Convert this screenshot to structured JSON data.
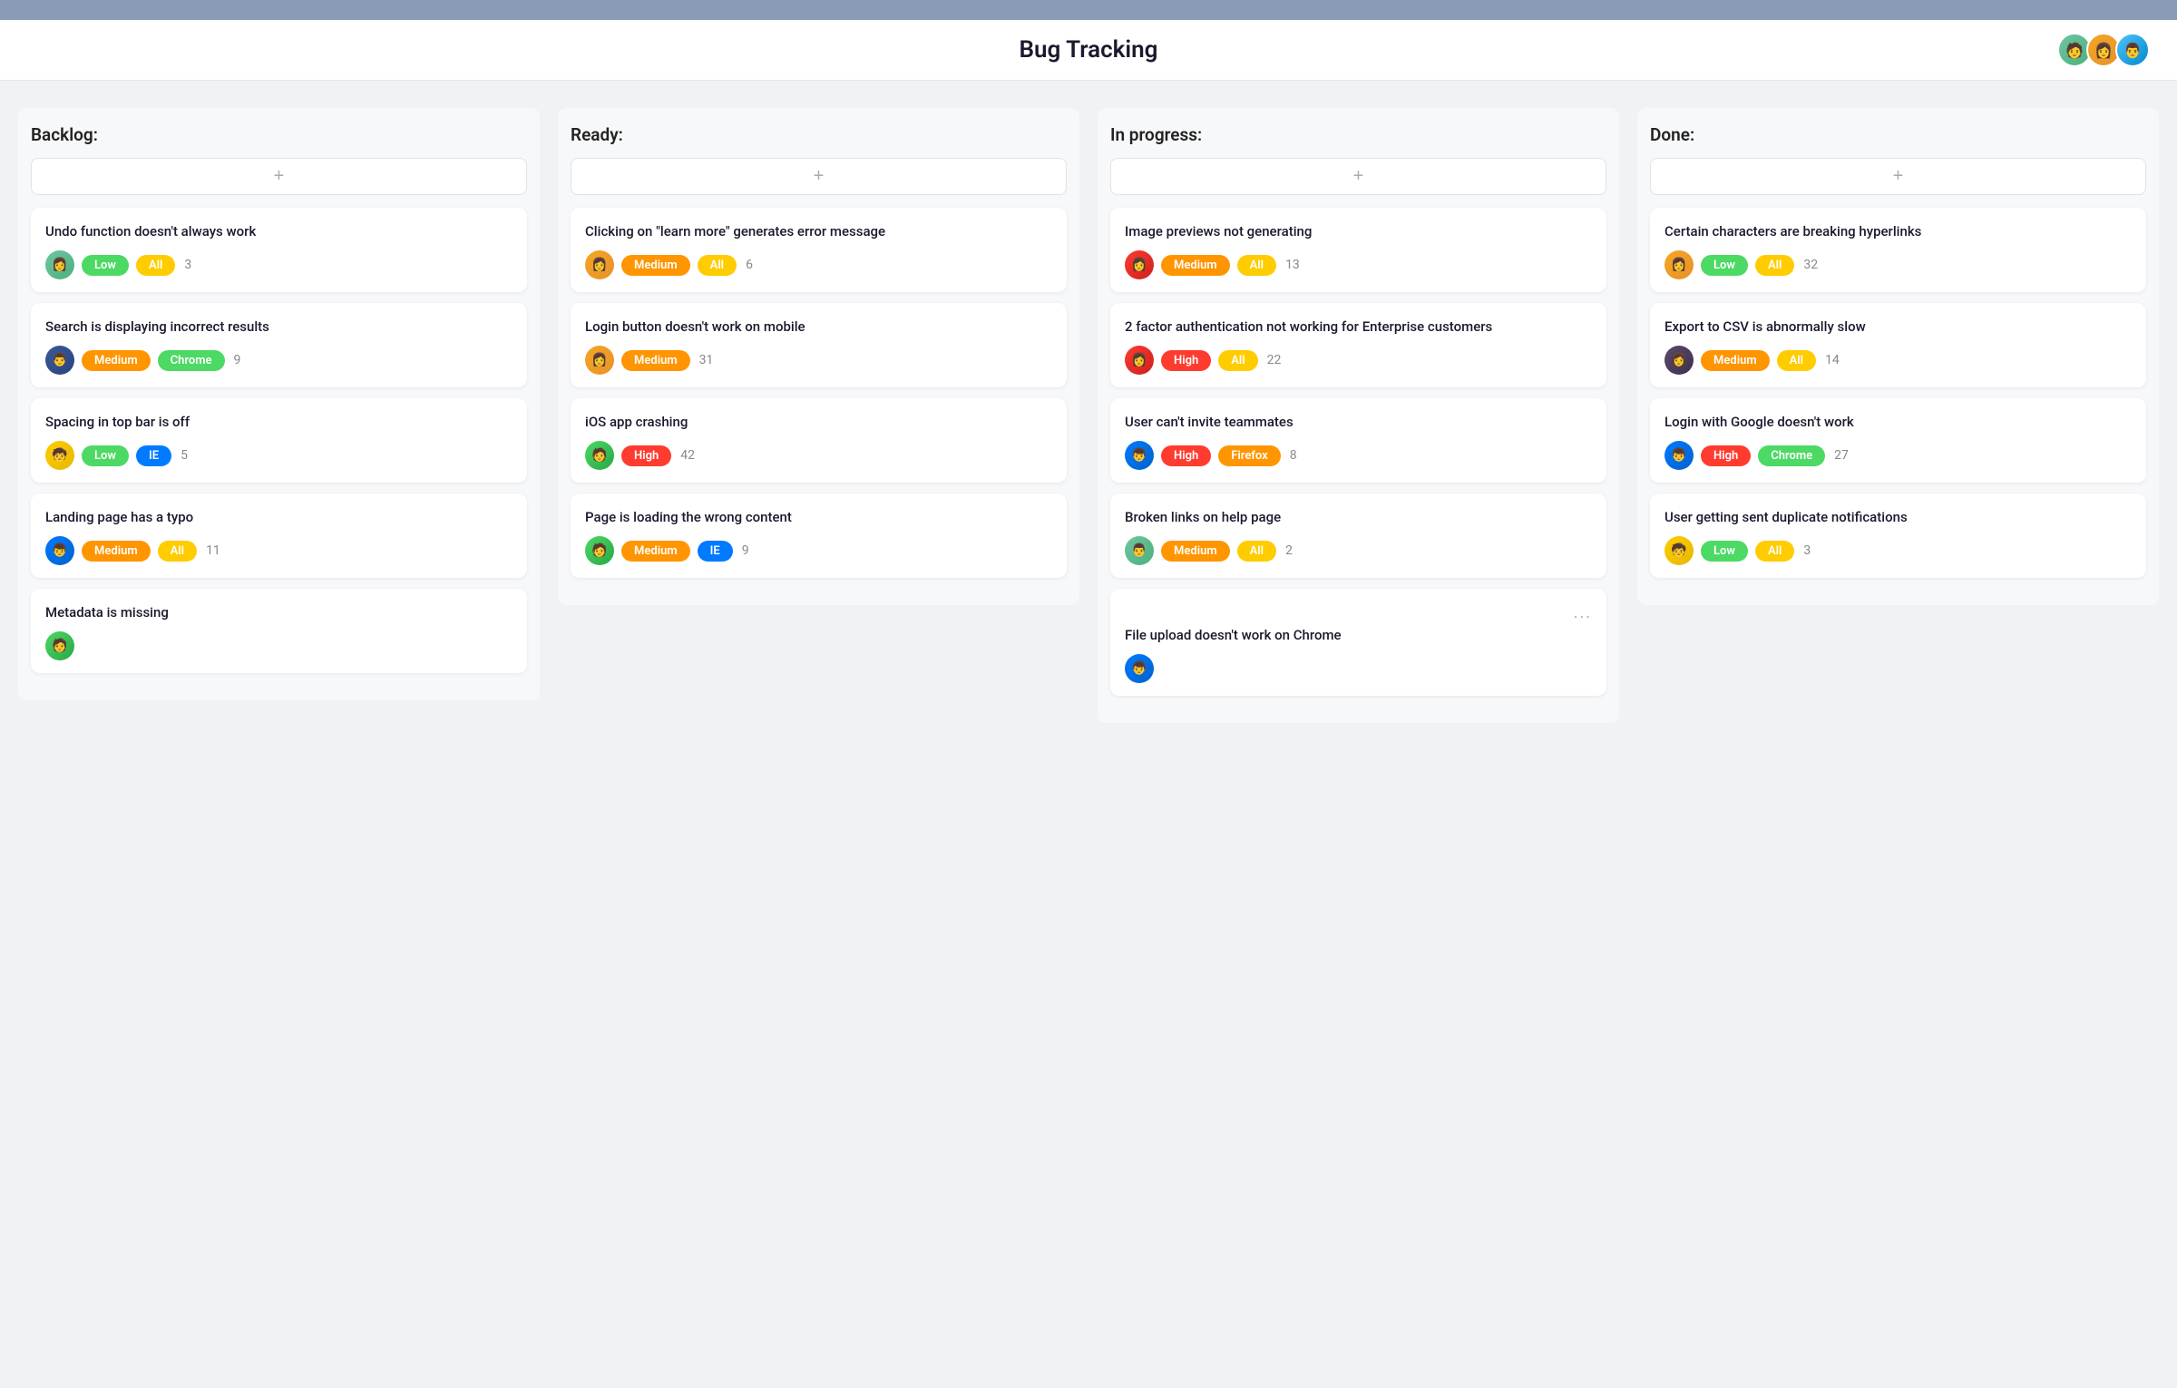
{
  "topBar": {},
  "header": {
    "title": "Bug Tracking",
    "avatars": [
      {
        "id": "av1",
        "label": "User 1",
        "color1": "#6ec6a0",
        "color2": "#4caf7d",
        "emoji": "🧑"
      },
      {
        "id": "av2",
        "label": "User 2",
        "color1": "#f5a623",
        "color2": "#e8922b",
        "emoji": "👩"
      },
      {
        "id": "av3",
        "label": "User 3",
        "color1": "#4fc3f7",
        "color2": "#0288d1",
        "emoji": "👨"
      }
    ]
  },
  "columns": [
    {
      "id": "backlog",
      "title": "Backlog:",
      "addLabel": "+",
      "cards": [
        {
          "id": "b1",
          "title": "Undo function doesn't always work",
          "avatar": {
            "bg": "#6ec6a0",
            "emoji": "👩"
          },
          "priority": "Low",
          "priorityClass": "badge-low",
          "platform": "All",
          "platformClass": "badge-all",
          "count": "3"
        },
        {
          "id": "b2",
          "title": "Search is displaying incorrect results",
          "avatar": {
            "bg": "#3b5998",
            "emoji": "👨"
          },
          "priority": "Medium",
          "priorityClass": "badge-medium",
          "platform": "Chrome",
          "platformClass": "badge-chrome",
          "count": "9"
        },
        {
          "id": "b3",
          "title": "Spacing in top bar is off",
          "avatar": {
            "bg": "#ffcc00",
            "emoji": "🧒"
          },
          "priority": "Low",
          "priorityClass": "badge-low",
          "platform": "IE",
          "platformClass": "badge-ie",
          "count": "5"
        },
        {
          "id": "b4",
          "title": "Landing page has a typo",
          "avatar": {
            "bg": "#007aff",
            "emoji": "👦"
          },
          "priority": "Medium",
          "priorityClass": "badge-medium",
          "platform": "All",
          "platformClass": "badge-all",
          "count": "11"
        },
        {
          "id": "b5",
          "title": "Metadata is missing",
          "avatar": {
            "bg": "#4cd964",
            "emoji": "🧑"
          },
          "priority": null,
          "platform": null,
          "count": null
        }
      ]
    },
    {
      "id": "ready",
      "title": "Ready:",
      "addLabel": "+",
      "cards": [
        {
          "id": "r1",
          "title": "Clicking on \"learn more\" generates error message",
          "avatar": {
            "bg": "#f5a623",
            "emoji": "👩"
          },
          "priority": "Medium",
          "priorityClass": "badge-medium",
          "platform": "All",
          "platformClass": "badge-all",
          "count": "6"
        },
        {
          "id": "r2",
          "title": "Login button doesn't work on mobile",
          "avatar": {
            "bg": "#f5a623",
            "emoji": "👩"
          },
          "priority": "Medium",
          "priorityClass": "badge-medium",
          "platform": null,
          "platformClass": null,
          "count": "31"
        },
        {
          "id": "r3",
          "title": "iOS app crashing",
          "avatar": {
            "bg": "#4cd964",
            "emoji": "🧑"
          },
          "priority": "High",
          "priorityClass": "badge-high",
          "platform": null,
          "platformClass": null,
          "count": "42"
        },
        {
          "id": "r4",
          "title": "Page is loading the wrong content",
          "avatar": {
            "bg": "#4cd964",
            "emoji": "🧑"
          },
          "priority": "Medium",
          "priorityClass": "badge-medium",
          "platform": "IE",
          "platformClass": "badge-ie",
          "count": "9"
        }
      ]
    },
    {
      "id": "inprogress",
      "title": "In progress:",
      "addLabel": "+",
      "cards": [
        {
          "id": "i1",
          "title": "Image previews not generating",
          "avatar": {
            "bg": "#ff3b30",
            "emoji": "👩"
          },
          "priority": "Medium",
          "priorityClass": "badge-medium",
          "platform": "All",
          "platformClass": "badge-all",
          "count": "13"
        },
        {
          "id": "i2",
          "title": "2 factor authentication not working for Enterprise customers",
          "avatar": {
            "bg": "#ff3b30",
            "emoji": "👩"
          },
          "priority": "High",
          "priorityClass": "badge-high",
          "platform": "All",
          "platformClass": "badge-all",
          "count": "22"
        },
        {
          "id": "i3",
          "title": "User can't invite teammates",
          "avatar": {
            "bg": "#007aff",
            "emoji": "👦"
          },
          "priority": "High",
          "priorityClass": "badge-high",
          "platform": "Firefox",
          "platformClass": "badge-firefox",
          "count": "8"
        },
        {
          "id": "i4",
          "title": "Broken links on help page",
          "avatar": {
            "bg": "#6ec6a0",
            "emoji": "👨"
          },
          "priority": "Medium",
          "priorityClass": "badge-medium",
          "platform": "All",
          "platformClass": "badge-all",
          "count": "2"
        },
        {
          "id": "i5",
          "title": "File upload doesn't work on Chrome",
          "avatar": {
            "bg": "#007aff",
            "emoji": "👦"
          },
          "priority": null,
          "platform": null,
          "count": null,
          "dots": "..."
        }
      ]
    },
    {
      "id": "done",
      "title": "Done:",
      "addLabel": "+",
      "cards": [
        {
          "id": "d1",
          "title": "Certain characters are breaking hyperlinks",
          "avatar": {
            "bg": "#f5a623",
            "emoji": "👩"
          },
          "priority": "Low",
          "priorityClass": "badge-low",
          "platform": "All",
          "platformClass": "badge-all",
          "count": "32"
        },
        {
          "id": "d2",
          "title": "Export to CSV is abnormally slow",
          "avatar": {
            "bg": "#5a4a6b",
            "emoji": "👩"
          },
          "priority": "Medium",
          "priorityClass": "badge-medium",
          "platform": "All",
          "platformClass": "badge-all",
          "count": "14"
        },
        {
          "id": "d3",
          "title": "Login with Google doesn't work",
          "avatar": {
            "bg": "#007aff",
            "emoji": "👦"
          },
          "priority": "High",
          "priorityClass": "badge-high",
          "platform": "Chrome",
          "platformClass": "badge-chrome",
          "count": "27"
        },
        {
          "id": "d4",
          "title": "User getting sent duplicate notifications",
          "avatar": {
            "bg": "#ffcc00",
            "emoji": "🧒"
          },
          "priority": "Low",
          "priorityClass": "badge-low",
          "platform": "All",
          "platformClass": "badge-all",
          "count": "3"
        }
      ]
    }
  ]
}
